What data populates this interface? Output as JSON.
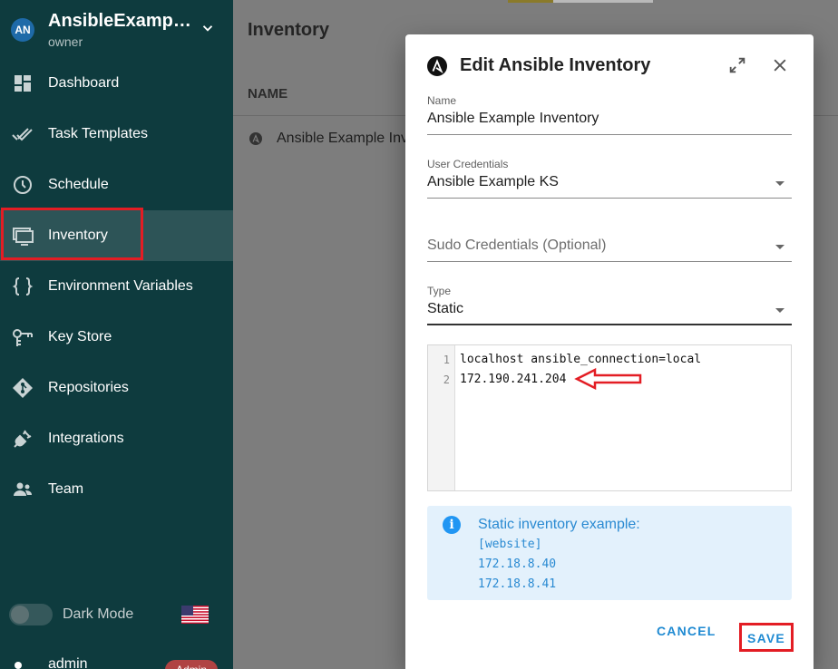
{
  "project": {
    "initials": "AN",
    "name": "AnsibleExampl...",
    "role": "owner"
  },
  "sidebar": {
    "items": [
      {
        "label": "Dashboard",
        "icon": "dashboard-icon"
      },
      {
        "label": "Task Templates",
        "icon": "done-all-icon"
      },
      {
        "label": "Schedule",
        "icon": "clock-icon"
      },
      {
        "label": "Inventory",
        "icon": "monitor-icon",
        "active": true
      },
      {
        "label": "Environment Variables",
        "icon": "braces-icon"
      },
      {
        "label": "Key Store",
        "icon": "key-icon"
      },
      {
        "label": "Repositories",
        "icon": "git-icon"
      },
      {
        "label": "Integrations",
        "icon": "plug-icon"
      },
      {
        "label": "Team",
        "icon": "team-icon"
      }
    ],
    "dark_mode_label": "Dark Mode",
    "user_name": "admin",
    "user_badge": "Admin"
  },
  "main": {
    "title": "Inventory",
    "column_name": "NAME",
    "row_text": "Ansible Example Inv"
  },
  "dialog": {
    "title": "Edit Ansible Inventory",
    "name_label": "Name",
    "name_value": "Ansible Example Inventory",
    "user_credentials_label": "User Credentials",
    "user_credentials_value": "Ansible Example KS",
    "sudo_credentials_placeholder": "Sudo Credentials (Optional)",
    "type_label": "Type",
    "type_value": "Static",
    "editor": {
      "line_numbers": [
        "1",
        "2"
      ],
      "lines": [
        "localhost ansible_connection=local",
        "172.190.241.204"
      ]
    },
    "info": {
      "title": "Static inventory example:",
      "lines": [
        "[website]",
        "172.18.8.40",
        "172.18.8.41"
      ]
    },
    "cancel_label": "CANCEL",
    "save_label": "SAVE"
  },
  "colors": {
    "sidebar_bg": "#0e3b3e",
    "accent": "#1f8ad2",
    "highlight": "#e31d24",
    "info_bg": "#e3f1fc"
  }
}
